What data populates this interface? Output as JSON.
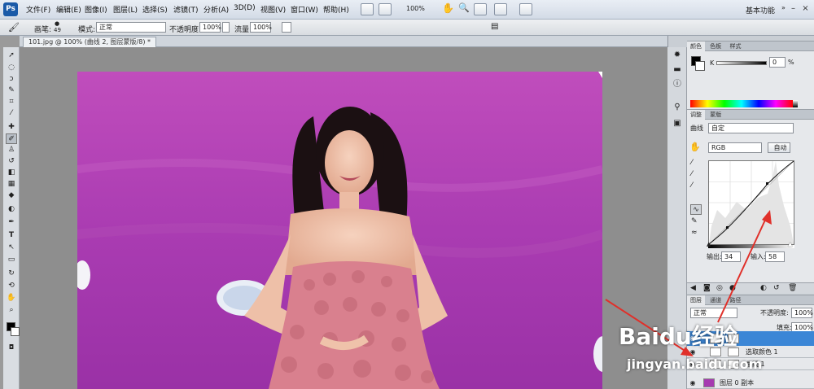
{
  "app": {
    "logo": "Ps"
  },
  "menu": [
    "文件(F)",
    "编辑(E)",
    "图像(I)",
    "图层(L)",
    "选择(S)",
    "滤镜(T)",
    "分析(A)",
    "3D(D)",
    "视图(V)",
    "窗口(W)",
    "帮助(H)"
  ],
  "menubar_right": {
    "zoom": "100%",
    "workspace": "基本功能"
  },
  "options": {
    "brush_label": "画笔:",
    "brush_size": "49",
    "mode_label": "模式:",
    "mode_value": "正常",
    "opacity_label": "不透明度:",
    "opacity_value": "100%",
    "flow_label": "流量:",
    "flow_value": "100%"
  },
  "document": {
    "tab_title": "101.jpg @ 100% (曲线 2, 图层蒙版/8) *"
  },
  "color_panel": {
    "tabs": [
      "颜色",
      "色板",
      "样式"
    ],
    "channel": "K",
    "value": "0",
    "unit": "%"
  },
  "adjustments_panel": {
    "tabs": [
      "调整",
      "蒙版"
    ],
    "type": "曲线",
    "preset": "自定",
    "channel": "RGB",
    "auto_label": "自动",
    "output_label": "输出:",
    "output_value": "34",
    "input_label": "输入:",
    "input_value": "58"
  },
  "layers_panel": {
    "tabs": [
      "图层",
      "通道",
      "路径"
    ],
    "blend_mode": "正常",
    "opacity_label": "不透明度:",
    "opacity_value": "100%",
    "fill_label": "填充:",
    "fill_value": "100%",
    "layers": [
      {
        "name": "选取颜色 1"
      },
      {
        "name": "曲线 1"
      },
      {
        "name": "图层 0 副本"
      }
    ]
  },
  "watermark": {
    "brand": "Baidu经验",
    "url": "jingyan.baidu.com"
  },
  "colors": {
    "accent_selection": "#3b86d6",
    "annotation_arrow": "#e0302a",
    "photo_bg": "#a63ab0"
  }
}
